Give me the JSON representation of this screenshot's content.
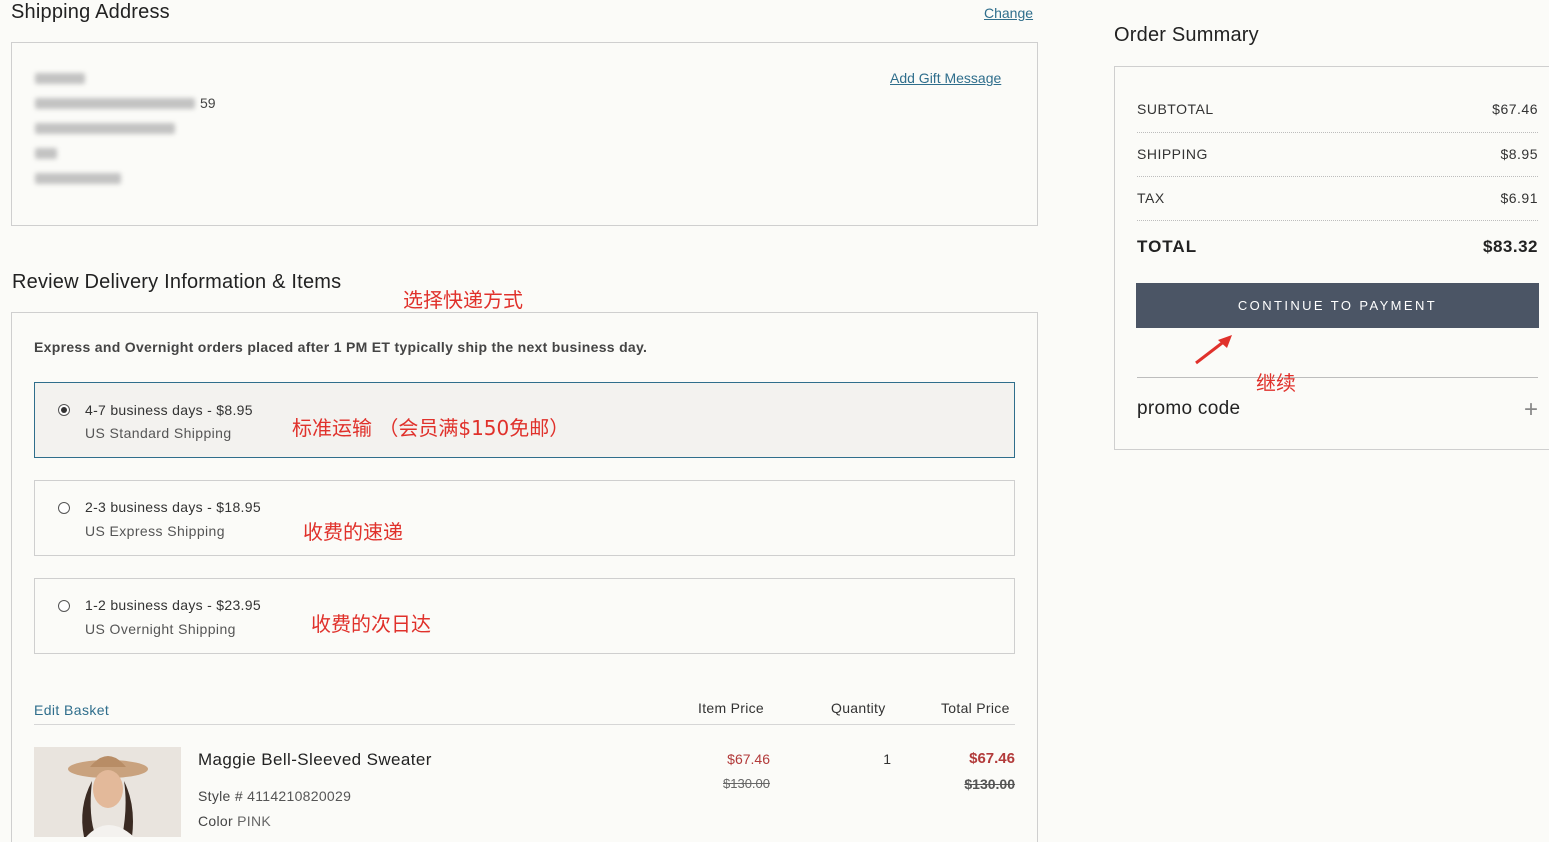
{
  "shipping_address": {
    "title": "Shipping Address",
    "change_link": "Change",
    "gift_message_link": "Add Gift Message",
    "visible_fragment": "59"
  },
  "delivery": {
    "title": "Review Delivery Information & Items",
    "notice": "Express and Overnight orders placed after 1 PM ET typically ship the next business day.",
    "options": [
      {
        "line1": "4-7 business days - $8.95",
        "line2": "US Standard Shipping",
        "selected": true
      },
      {
        "line1": "2-3 business days - $18.95",
        "line2": "US Express Shipping",
        "selected": false
      },
      {
        "line1": "1-2 business days - $23.95",
        "line2": "US Overnight Shipping",
        "selected": false
      }
    ]
  },
  "items": {
    "edit_link": "Edit Basket",
    "columns": {
      "item_price": "Item Price",
      "quantity": "Quantity",
      "total_price": "Total Price"
    },
    "rows": [
      {
        "name": "Maggie Bell-Sleeved Sweater",
        "style_label": "Style #",
        "style_value": "4114210820029",
        "color_label": "Color",
        "color_value": "PINK",
        "price": "$67.46",
        "orig_price": "$130.00",
        "quantity": "1",
        "total": "$67.46",
        "orig_total": "$130.00"
      }
    ]
  },
  "summary": {
    "title": "Order Summary",
    "rows": [
      {
        "label": "SUBTOTAL",
        "value": "$67.46"
      },
      {
        "label": "SHIPPING",
        "value": "$8.95"
      },
      {
        "label": "TAX",
        "value": "$6.91"
      }
    ],
    "total_label": "TOTAL",
    "total_value": "$83.32",
    "continue_button": "CONTINUE TO PAYMENT",
    "promo_label": "promo code",
    "promo_toggle": "+"
  },
  "annotations": {
    "choose_shipping": "选择快递方式",
    "standard": "标准运输 （会员满$150免邮）",
    "express": "收费的速递",
    "overnight": "收费的次日达",
    "continue": "继续"
  },
  "colors": {
    "accent": "#2f6e8c",
    "button": "#4b5565",
    "sale": "#b23a3a",
    "annotation": "#e0312b"
  }
}
